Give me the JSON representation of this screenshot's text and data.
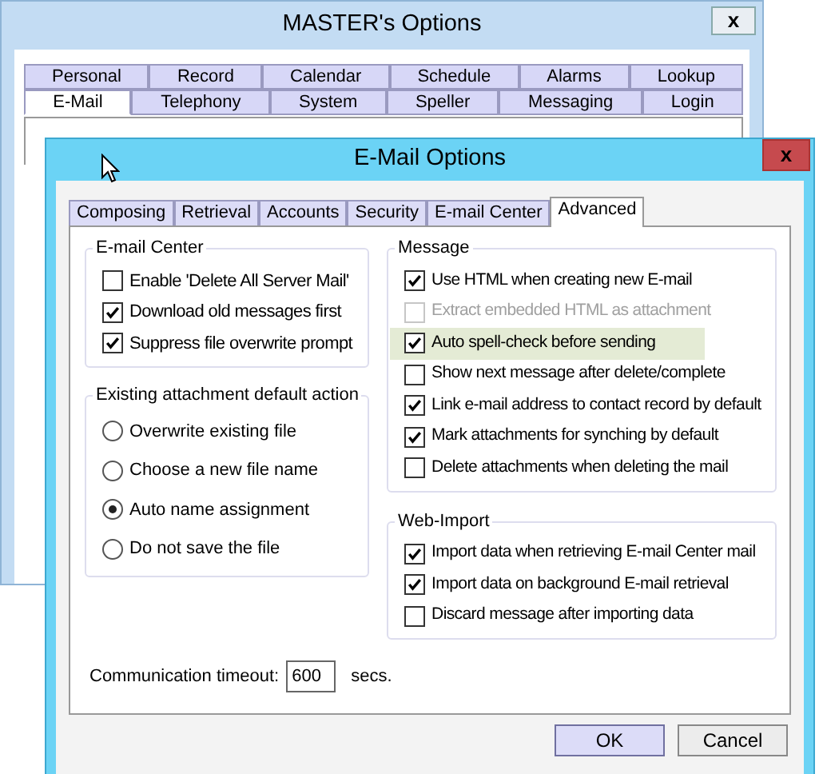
{
  "back_window": {
    "title": "MASTER's Options",
    "close": "x",
    "tab_rows": [
      [
        {
          "label": "Personal",
          "selected": false
        },
        {
          "label": "Record",
          "selected": false
        },
        {
          "label": "Calendar",
          "selected": false
        },
        {
          "label": "Schedule",
          "selected": false
        },
        {
          "label": "Alarms",
          "selected": false
        },
        {
          "label": "Lookup",
          "selected": false
        }
      ],
      [
        {
          "label": "E-Mail",
          "selected": true
        },
        {
          "label": "Telephony",
          "selected": false
        },
        {
          "label": "System",
          "selected": false
        },
        {
          "label": "Speller",
          "selected": false
        },
        {
          "label": "Messaging",
          "selected": false
        },
        {
          "label": "Login",
          "selected": false
        }
      ]
    ]
  },
  "dialog": {
    "title": "E-Mail Options",
    "close": "x",
    "tabs": [
      {
        "label": "Composing",
        "selected": false
      },
      {
        "label": "Retrieval",
        "selected": false
      },
      {
        "label": "Accounts",
        "selected": false
      },
      {
        "label": "Security",
        "selected": false
      },
      {
        "label": "E-mail Center",
        "selected": false
      },
      {
        "label": "Advanced",
        "selected": true
      }
    ],
    "email_center": {
      "title": "E-mail Center",
      "items": [
        {
          "label": "Enable 'Delete All Server Mail'",
          "checked": false
        },
        {
          "label": "Download old messages first",
          "checked": true
        },
        {
          "label": "Suppress file overwrite prompt",
          "checked": true
        }
      ]
    },
    "attachment_action": {
      "title": "Existing attachment default action",
      "options": [
        {
          "label": "Overwrite existing file",
          "selected": false
        },
        {
          "label": "Choose a new file name",
          "selected": false
        },
        {
          "label": "Auto name assignment",
          "selected": true
        },
        {
          "label": "Do not save the file",
          "selected": false
        }
      ]
    },
    "message": {
      "title": "Message",
      "items": [
        {
          "label": "Use HTML when creating new E-mail",
          "checked": true,
          "disabled": false,
          "highlighted": false
        },
        {
          "label": "Extract embedded HTML as attachment",
          "checked": false,
          "disabled": true,
          "highlighted": false
        },
        {
          "label": "Auto spell-check before sending",
          "checked": true,
          "disabled": false,
          "highlighted": true
        },
        {
          "label": "Show next message after delete/complete",
          "checked": false,
          "disabled": false,
          "highlighted": false
        },
        {
          "label": "Link e-mail address to contact record by default",
          "checked": true,
          "disabled": false,
          "highlighted": false
        },
        {
          "label": "Mark attachments for synching by default",
          "checked": true,
          "disabled": false,
          "highlighted": false
        },
        {
          "label": "Delete attachments when deleting the mail",
          "checked": false,
          "disabled": false,
          "highlighted": false
        }
      ]
    },
    "web_import": {
      "title": "Web-Import",
      "items": [
        {
          "label": "Import data when retrieving E-mail Center mail",
          "checked": true
        },
        {
          "label": "Import data on background E-mail retrieval",
          "checked": true
        },
        {
          "label": "Discard message after importing data",
          "checked": false
        }
      ]
    },
    "timeout": {
      "label": "Communication timeout:",
      "value": "600",
      "unit": "secs."
    },
    "buttons": [
      "OK",
      "Cancel"
    ]
  }
}
